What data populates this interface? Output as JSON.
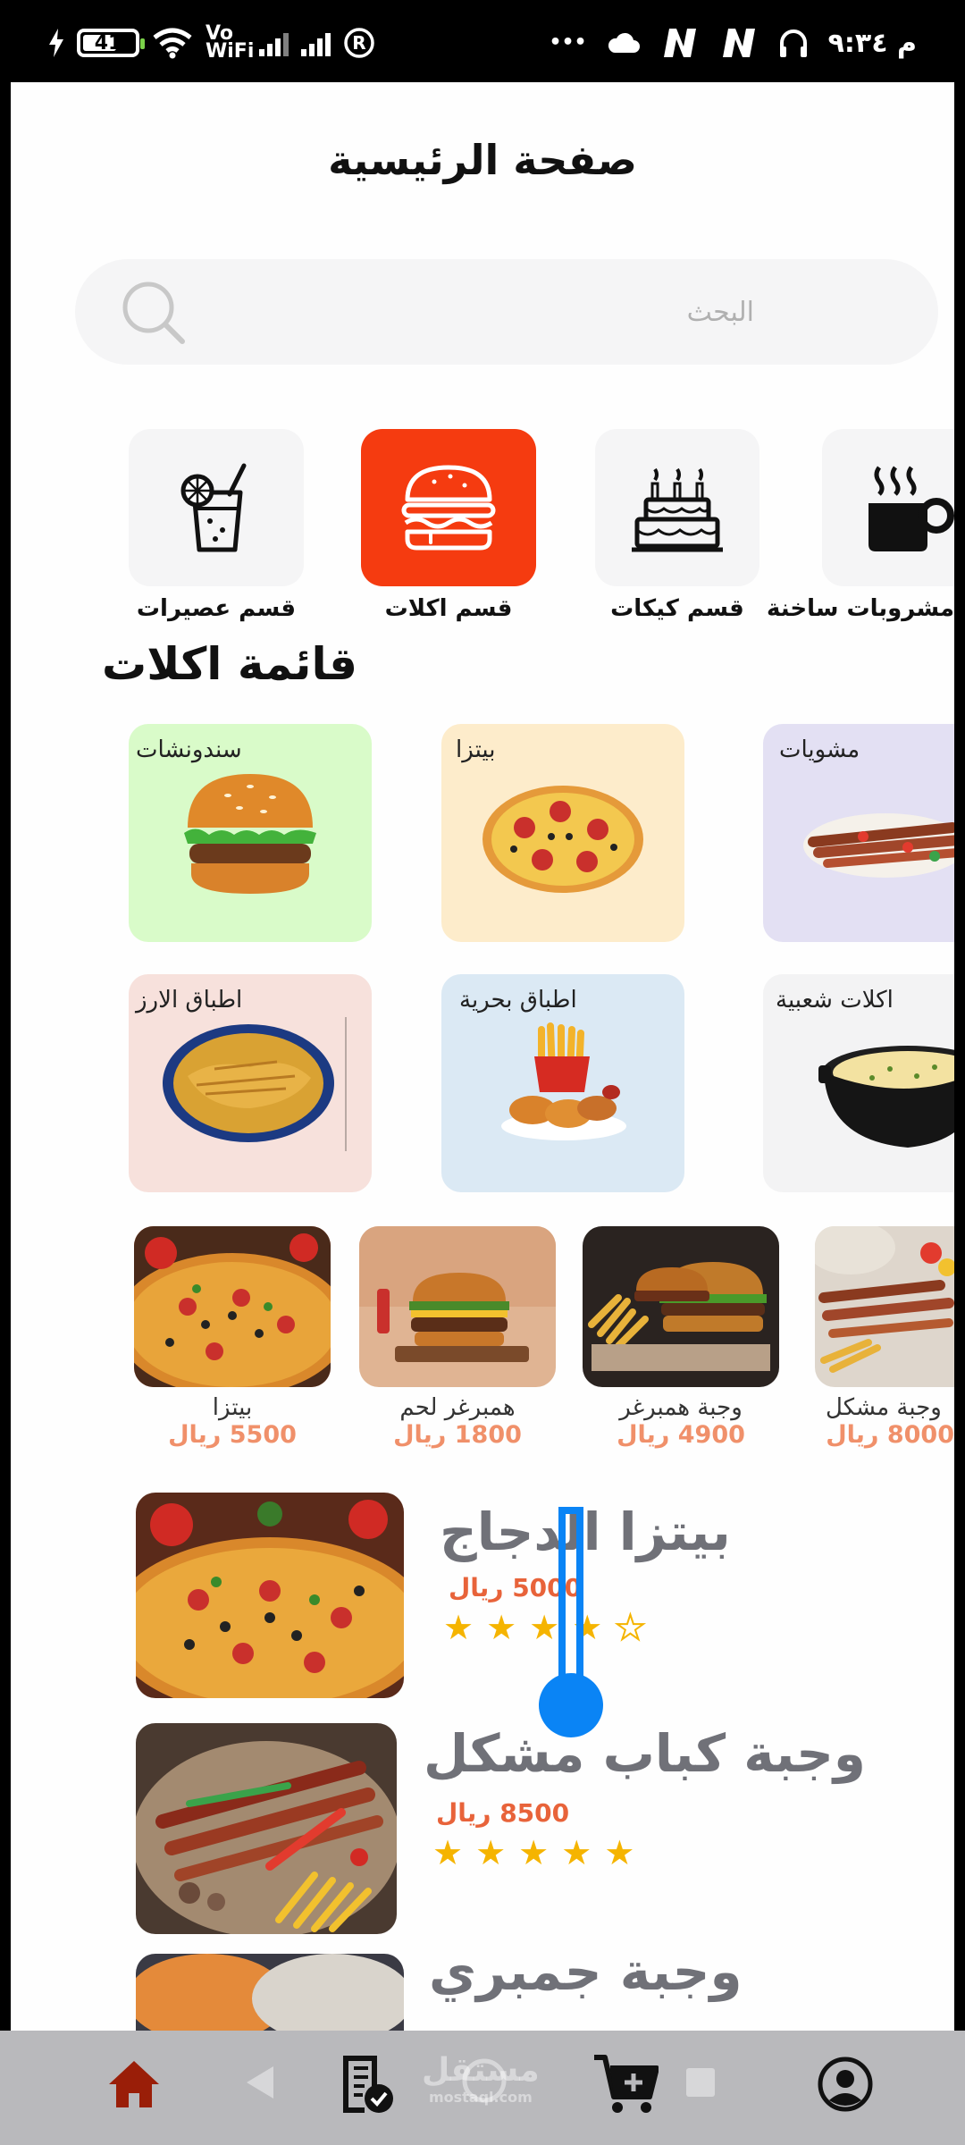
{
  "status_bar": {
    "battery_percent": "41",
    "network_label": "Vo WiFi",
    "time": "م ٩:٣٤",
    "more_indicator": "•••"
  },
  "page": {
    "title": "صفحة الرئيسية"
  },
  "search": {
    "placeholder": "البحث"
  },
  "categories": [
    {
      "label": "قسم عصيرات",
      "icon": "juice-icon",
      "active": false
    },
    {
      "label": "قسم اكلات",
      "icon": "burger-icon",
      "active": true
    },
    {
      "label": "قسم كيكات",
      "icon": "cake-icon",
      "active": false
    },
    {
      "label": "مشروبات ساخنة",
      "icon": "hot-drink-icon",
      "active": false
    }
  ],
  "food_section": {
    "title": "قائمة اكلات"
  },
  "food_tiles": [
    {
      "label": "سندونشات",
      "bg": "#d9fbc9"
    },
    {
      "label": "بيتزا",
      "bg": "#fdeccb"
    },
    {
      "label": "مشويات",
      "bg": "#e3e0f3"
    },
    {
      "label": "اطباق الارز",
      "bg": "#f7e1dc"
    },
    {
      "label": "اطباق بحرية",
      "bg": "#dbe9f4"
    },
    {
      "label": "اكلات شعبية",
      "bg": "#f3f3f4"
    }
  ],
  "products": [
    {
      "name": "بيتزا",
      "price": "5500 ريال"
    },
    {
      "name": "همبرغر لحم",
      "price": "1800 ريال"
    },
    {
      "name": "وجبة همبرغر",
      "price": "4900 ريال"
    },
    {
      "name": "وجبة مشكل",
      "price": "8000 ريال"
    }
  ],
  "list_items": [
    {
      "title": "بيتزا الدجاج",
      "price": "5000 ريال",
      "rating": 4
    },
    {
      "title": "وجبة كباب مشكل",
      "price": "8500 ريال",
      "rating": 5
    },
    {
      "title": "وجبة جمبري",
      "price": "",
      "rating": 0
    }
  ],
  "watermark": {
    "text": "مستقل",
    "sub": "mostaql.com"
  },
  "bottom_nav": [
    "home-icon",
    "orders-icon",
    "cart-icon",
    "profile-icon"
  ],
  "colors": {
    "accent": "#f53b10",
    "price": "#e8633a",
    "star": "#f5b400",
    "handle": "#0a84f5"
  }
}
